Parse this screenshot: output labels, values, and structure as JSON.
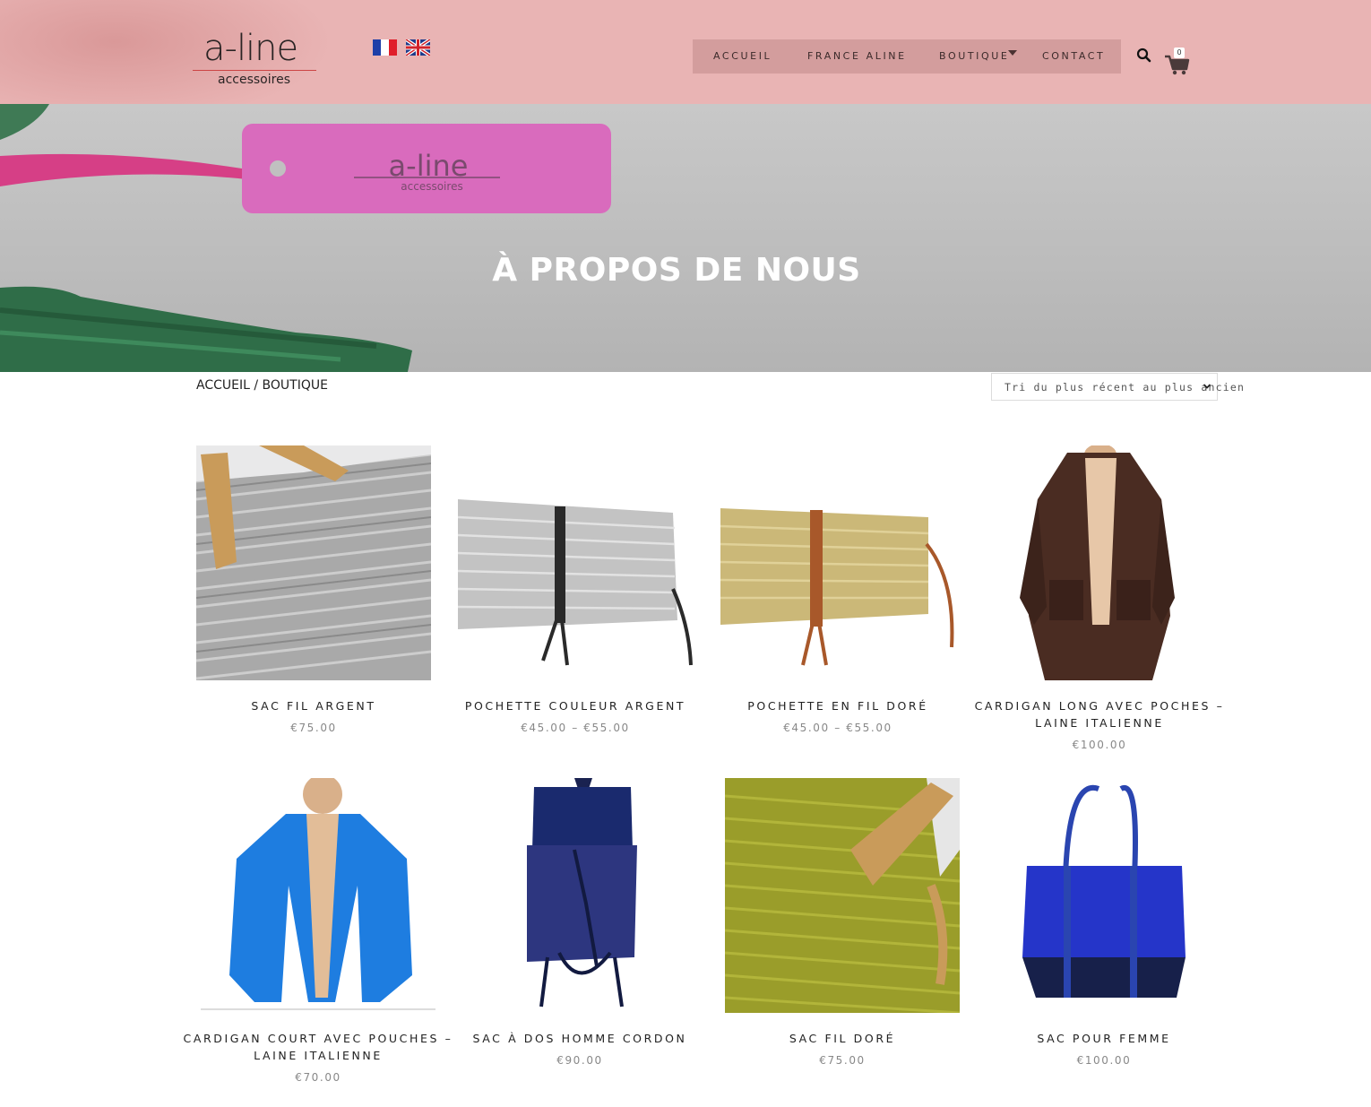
{
  "brand": {
    "logo_word": "a-line",
    "logo_sub": "accessoires"
  },
  "languages": [
    {
      "code": "fr",
      "icon": "flag-france-icon"
    },
    {
      "code": "en",
      "icon": "flag-uk-icon"
    }
  ],
  "nav": {
    "items": [
      {
        "label": "ACCUEIL"
      },
      {
        "label": "FRANCE ALINE"
      },
      {
        "label": "BOUTIQUE"
      },
      {
        "label": "CONTACT"
      }
    ]
  },
  "cart": {
    "count": "0"
  },
  "hero": {
    "title": "À PROPOS DE NOUS",
    "tag_word": "a-line",
    "tag_sub": "accessoires"
  },
  "breadcrumb": {
    "home": "ACCUEIL",
    "separator": " / ",
    "current": "BOUTIQUE"
  },
  "sort": {
    "selected": "Tri du plus récent au plus ancien"
  },
  "products": [
    {
      "name": "SAC FIL ARGENT",
      "price": "€75.00"
    },
    {
      "name": "POCHETTE COULEUR ARGENT",
      "price": "€45.00 – €55.00"
    },
    {
      "name": "POCHETTE EN FIL DORÉ",
      "price": "€45.00 – €55.00"
    },
    {
      "name": "CARDIGAN LONG AVEC POCHES – LAINE ITALIENNE",
      "price": "€100.00"
    },
    {
      "name": "CARDIGAN COURT AVEC POUCHES – LAINE ITALIENNE",
      "price": "€70.00"
    },
    {
      "name": "SAC À DOS HOMME CORDON",
      "price": "€90.00"
    },
    {
      "name": "SAC FIL DORÉ",
      "price": "€75.00"
    },
    {
      "name": "SAC POUR FEMME",
      "price": "€100.00"
    }
  ],
  "colors": {
    "header_bg": "#e9b4b4",
    "nav_bg": "#d39d9d",
    "text": "#222222",
    "price": "#888888"
  }
}
